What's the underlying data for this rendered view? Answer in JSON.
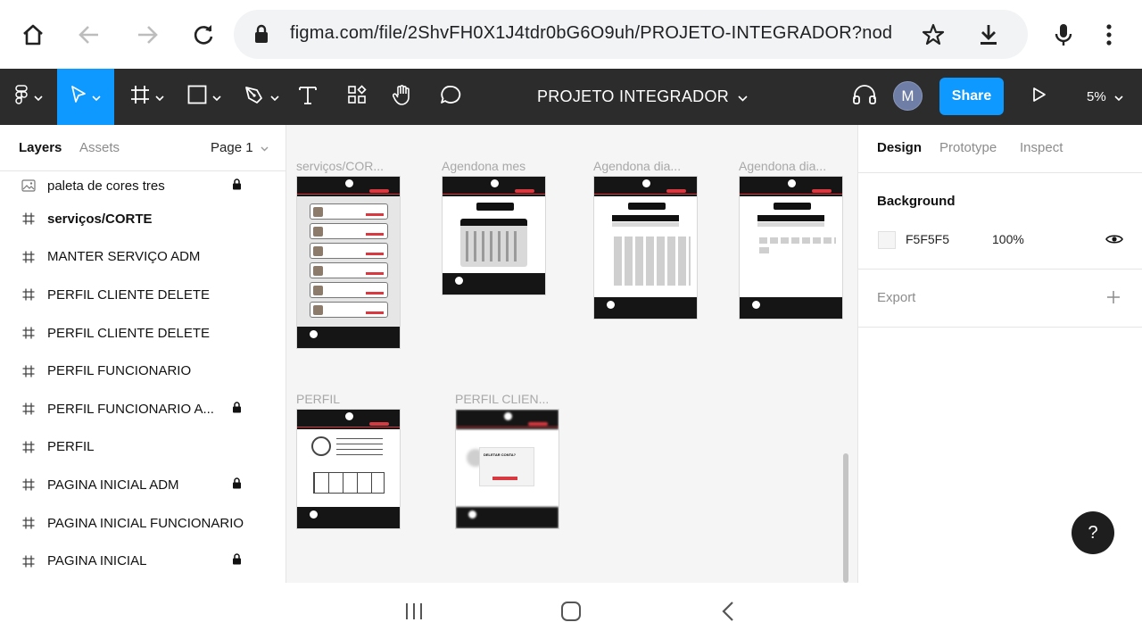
{
  "browser": {
    "url": "figma.com/file/2ShvFH0X1J4tdr0bG6O9uh/PROJETO-INTEGRADOR?nod",
    "icons": [
      "home-icon",
      "back-icon",
      "forward-icon",
      "reload-icon",
      "lock-icon",
      "star-icon",
      "download-icon",
      "mic-icon",
      "more-icon"
    ]
  },
  "toolbar": {
    "file_title": "PROJETO INTEGRADOR",
    "avatar_initial": "M",
    "share_label": "Share",
    "zoom": "5%",
    "tools": [
      "main-menu",
      "move",
      "frame",
      "shape",
      "pen",
      "text",
      "resources",
      "hand",
      "comment"
    ]
  },
  "left_panel": {
    "tabs": {
      "layers": "Layers",
      "assets": "Assets"
    },
    "page_selector": "Page 1",
    "layers": [
      {
        "name": "paleta de cores tres",
        "type": "image",
        "locked": true,
        "bold": false
      },
      {
        "name": "serviços/CORTE",
        "type": "frame",
        "locked": false,
        "bold": true
      },
      {
        "name": "MANTER SERVIÇO ADM",
        "type": "frame",
        "locked": false,
        "bold": false
      },
      {
        "name": "PERFIL CLIENTE DELETE",
        "type": "frame",
        "locked": false,
        "bold": false
      },
      {
        "name": "PERFIL CLIENTE DELETE",
        "type": "frame",
        "locked": false,
        "bold": false
      },
      {
        "name": "PERFIL FUNCIONARIO",
        "type": "frame",
        "locked": false,
        "bold": false
      },
      {
        "name": "PERFIL FUNCIONARIO A...",
        "type": "frame",
        "locked": true,
        "bold": false
      },
      {
        "name": "PERFIL",
        "type": "frame",
        "locked": false,
        "bold": false
      },
      {
        "name": "PAGINA INICIAL ADM",
        "type": "frame",
        "locked": true,
        "bold": false
      },
      {
        "name": "PAGINA INICIAL FUNCIONARIO",
        "type": "frame",
        "locked": false,
        "bold": false
      },
      {
        "name": "PAGINA INICIAL",
        "type": "frame",
        "locked": true,
        "bold": false
      }
    ]
  },
  "canvas": {
    "frames": [
      {
        "label": "serviços/COR..."
      },
      {
        "label": "Agendona mes"
      },
      {
        "label": "Agendona dia..."
      },
      {
        "label": "Agendona dia..."
      },
      {
        "label": "PERFIL"
      },
      {
        "label": "PERFIL CLIEN..."
      }
    ],
    "delete_modal_text": "DELETAR CONTA?"
  },
  "right_panel": {
    "tabs": {
      "design": "Design",
      "prototype": "Prototype",
      "inspect": "Inspect"
    },
    "background_title": "Background",
    "background_hex": "F5F5F5",
    "background_opacity": "100%",
    "export_title": "Export"
  },
  "colors": {
    "figma_blue": "#0d99ff",
    "toolbar_dark": "#2c2c2c",
    "accent_red": "#d8383f"
  },
  "help_label": "?"
}
